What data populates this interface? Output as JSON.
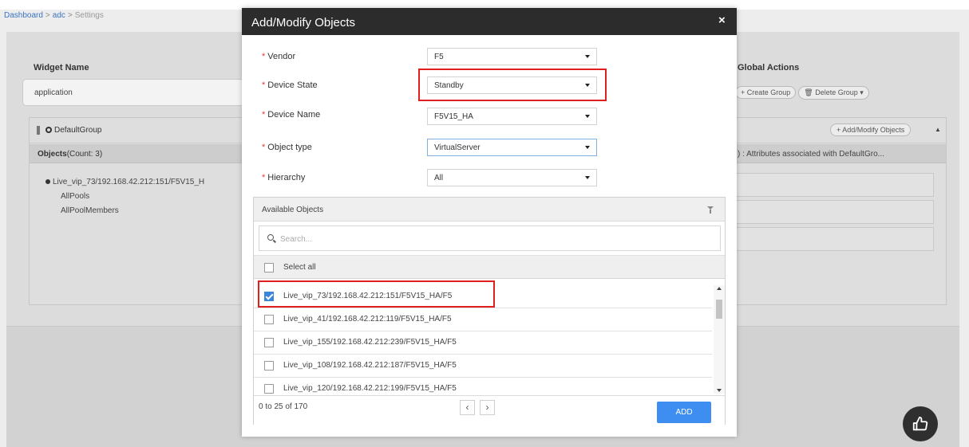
{
  "breadcrumb": {
    "home": "Dashboard",
    "sep": ">",
    "mid": "adc",
    "current": "Settings"
  },
  "background": {
    "widget_label": "Widget Name",
    "widget_value": "application",
    "global_label": "Global Actions",
    "create_group": "+ Create Group",
    "delete_group": "🗑 Delete Group ▾",
    "group_name": "DefaultGroup",
    "add_modify_pill": "+ Add/Modify Objects",
    "objects_title": "Objects",
    "objects_count": "(Count: 3)",
    "attr_text": ") : Attributes associated with DefaultGro...",
    "tree": {
      "root": "Live_vip_73/192.168.42.212:151/F5V15_H",
      "children": [
        "AllPools",
        "AllPoolMembers"
      ]
    }
  },
  "modal": {
    "title": "Add/Modify Objects",
    "close": "×",
    "fields": {
      "vendor": {
        "label": "Vendor",
        "value": "F5"
      },
      "device_state": {
        "label": "Device State",
        "value": "Standby"
      },
      "device_name": {
        "label": "Device Name",
        "value": "F5V15_HA"
      },
      "object_type": {
        "label": "Object type",
        "value": "VirtualServer"
      },
      "hierarchy": {
        "label": "Hierarchy",
        "value": "All"
      }
    },
    "available": {
      "title": "Available Objects",
      "search_placeholder": "Search...",
      "select_all": "Select all",
      "items": [
        {
          "label": "Live_vip_73/192.168.42.212:151/F5V15_HA/F5",
          "checked": true
        },
        {
          "label": "Live_vip_41/192.168.42.212:119/F5V15_HA/F5",
          "checked": false
        },
        {
          "label": "Live_vip_155/192.168.42.212:239/F5V15_HA/F5",
          "checked": false
        },
        {
          "label": "Live_vip_108/192.168.42.212:187/F5V15_HA/F5",
          "checked": false
        },
        {
          "label": "Live_vip_120/192.168.42.212:199/F5V15_HA/F5",
          "checked": false
        }
      ],
      "range": "0 to 25 of 170",
      "prev": "‹",
      "next": "›",
      "add": "ADD"
    }
  },
  "colors": {
    "accent": "#3d8ef0",
    "header": "#2c2c2c",
    "highlight": "#e01f1f",
    "required": "#e53935"
  },
  "icons": {
    "thumbs_up": "thumbs-up-icon",
    "filter": "filter-icon",
    "search": "search-icon",
    "close": "close-icon"
  }
}
